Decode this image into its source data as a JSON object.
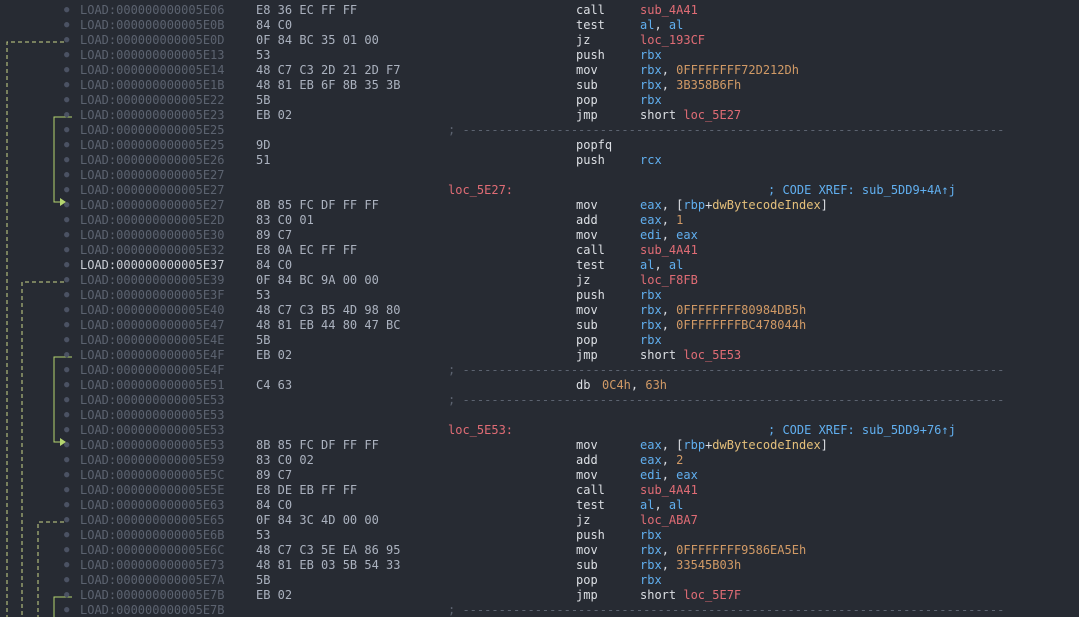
{
  "address_prefix": "LOAD:",
  "lines": [
    {
      "addr": "000000000005E06",
      "bytes": "E8 36 EC FF FF",
      "mnem": "call",
      "ops": [
        {
          "t": "sub_4A41",
          "c": "sym"
        }
      ]
    },
    {
      "addr": "000000000005E0B",
      "bytes": "84 C0",
      "mnem": "test",
      "ops": [
        {
          "t": "al",
          "c": "reg"
        },
        {
          "t": ", ",
          "c": "punc"
        },
        {
          "t": "al",
          "c": "reg"
        }
      ]
    },
    {
      "addr": "000000000005E0D",
      "bytes": "0F 84 BC 35 01 00",
      "mnem": "jz",
      "ops": [
        {
          "t": "loc_193CF",
          "c": "sym"
        }
      ]
    },
    {
      "addr": "000000000005E13",
      "bytes": "53",
      "mnem": "push",
      "ops": [
        {
          "t": "rbx",
          "c": "reg"
        }
      ]
    },
    {
      "addr": "000000000005E14",
      "bytes": "48 C7 C3 2D 21 2D F7",
      "mnem": "mov",
      "ops": [
        {
          "t": "rbx",
          "c": "reg"
        },
        {
          "t": ", ",
          "c": "punc"
        },
        {
          "t": "0FFFFFFFF72D212Dh",
          "c": "num"
        }
      ]
    },
    {
      "addr": "000000000005E1B",
      "bytes": "48 81 EB 6F 8B 35 3B",
      "mnem": "sub",
      "ops": [
        {
          "t": "rbx",
          "c": "reg"
        },
        {
          "t": ", ",
          "c": "punc"
        },
        {
          "t": "3B358B6Fh",
          "c": "num"
        }
      ]
    },
    {
      "addr": "000000000005E22",
      "bytes": "5B",
      "mnem": "pop",
      "ops": [
        {
          "t": "rbx",
          "c": "reg"
        }
      ]
    },
    {
      "addr": "000000000005E23",
      "bytes": "EB 02",
      "mnem": "jmp",
      "ops": [
        {
          "t": "short ",
          "c": "punc"
        },
        {
          "t": "loc_5E27",
          "c": "sym"
        }
      ]
    },
    {
      "addr": "000000000005E25",
      "sep": "; ---------------------------------------------------------------------------"
    },
    {
      "addr": "000000000005E25",
      "bytes": "9D",
      "mnem": "popfq",
      "ops": []
    },
    {
      "addr": "000000000005E26",
      "bytes": "51",
      "mnem": "push",
      "ops": [
        {
          "t": "rcx",
          "c": "reg"
        }
      ]
    },
    {
      "addr": "000000000005E27"
    },
    {
      "addr": "000000000005E27",
      "label": "loc_5E27:",
      "xref": "; CODE XREF: sub_5DD9+4A↑j"
    },
    {
      "addr": "000000000005E27",
      "bytes": "8B 85 FC DF FF FF",
      "mnem": "mov",
      "ops": [
        {
          "t": "eax",
          "c": "reg"
        },
        {
          "t": ", [",
          "c": "punc"
        },
        {
          "t": "rbp",
          "c": "reg"
        },
        {
          "t": "+",
          "c": "punc"
        },
        {
          "t": "dwBytecodeIndex",
          "c": "var"
        },
        {
          "t": "]",
          "c": "punc"
        }
      ]
    },
    {
      "addr": "000000000005E2D",
      "bytes": "83 C0 01",
      "mnem": "add",
      "ops": [
        {
          "t": "eax",
          "c": "reg"
        },
        {
          "t": ", ",
          "c": "punc"
        },
        {
          "t": "1",
          "c": "num"
        }
      ]
    },
    {
      "addr": "000000000005E30",
      "bytes": "89 C7",
      "mnem": "mov",
      "ops": [
        {
          "t": "edi",
          "c": "reg"
        },
        {
          "t": ", ",
          "c": "punc"
        },
        {
          "t": "eax",
          "c": "reg"
        }
      ]
    },
    {
      "addr": "000000000005E32",
      "bytes": "E8 0A EC FF FF",
      "mnem": "call",
      "ops": [
        {
          "t": "sub_4A41",
          "c": "sym"
        }
      ]
    },
    {
      "addr": "000000000005E37",
      "bytes": "84 C0",
      "mnem": "test",
      "ops": [
        {
          "t": "al",
          "c": "reg"
        },
        {
          "t": ", ",
          "c": "punc"
        },
        {
          "t": "al",
          "c": "reg"
        }
      ],
      "hl": true
    },
    {
      "addr": "000000000005E39",
      "bytes": "0F 84 BC 9A 00 00",
      "mnem": "jz",
      "ops": [
        {
          "t": "loc_F8FB",
          "c": "sym"
        }
      ]
    },
    {
      "addr": "000000000005E3F",
      "bytes": "53",
      "mnem": "push",
      "ops": [
        {
          "t": "rbx",
          "c": "reg"
        }
      ]
    },
    {
      "addr": "000000000005E40",
      "bytes": "48 C7 C3 B5 4D 98 80",
      "mnem": "mov",
      "ops": [
        {
          "t": "rbx",
          "c": "reg"
        },
        {
          "t": ", ",
          "c": "punc"
        },
        {
          "t": "0FFFFFFFF80984DB5h",
          "c": "num"
        }
      ]
    },
    {
      "addr": "000000000005E47",
      "bytes": "48 81 EB 44 80 47 BC",
      "mnem": "sub",
      "ops": [
        {
          "t": "rbx",
          "c": "reg"
        },
        {
          "t": ", ",
          "c": "punc"
        },
        {
          "t": "0FFFFFFFFBC478044h",
          "c": "num"
        }
      ]
    },
    {
      "addr": "000000000005E4E",
      "bytes": "5B",
      "mnem": "pop",
      "ops": [
        {
          "t": "rbx",
          "c": "reg"
        }
      ]
    },
    {
      "addr": "000000000005E4F",
      "bytes": "EB 02",
      "mnem": "jmp",
      "ops": [
        {
          "t": "short ",
          "c": "punc"
        },
        {
          "t": "loc_5E53",
          "c": "sym"
        }
      ]
    },
    {
      "addr": "000000000005E4F",
      "sep": "; ---------------------------------------------------------------------------"
    },
    {
      "addr": "000000000005E51",
      "bytes": "C4 63",
      "mnem": "db",
      "ops": [
        {
          "t": "0C4h",
          "c": "num"
        },
        {
          "t": ", ",
          "c": "punc"
        },
        {
          "t": "63h",
          "c": "num"
        }
      ],
      "opsAtMnemEnd": true
    },
    {
      "addr": "000000000005E53",
      "sep": "; ---------------------------------------------------------------------------"
    },
    {
      "addr": "000000000005E53"
    },
    {
      "addr": "000000000005E53",
      "label": "loc_5E53:",
      "xref": "; CODE XREF: sub_5DD9+76↑j"
    },
    {
      "addr": "000000000005E53",
      "bytes": "8B 85 FC DF FF FF",
      "mnem": "mov",
      "ops": [
        {
          "t": "eax",
          "c": "reg"
        },
        {
          "t": ", [",
          "c": "punc"
        },
        {
          "t": "rbp",
          "c": "reg"
        },
        {
          "t": "+",
          "c": "punc"
        },
        {
          "t": "dwBytecodeIndex",
          "c": "var"
        },
        {
          "t": "]",
          "c": "punc"
        }
      ]
    },
    {
      "addr": "000000000005E59",
      "bytes": "83 C0 02",
      "mnem": "add",
      "ops": [
        {
          "t": "eax",
          "c": "reg"
        },
        {
          "t": ", ",
          "c": "punc"
        },
        {
          "t": "2",
          "c": "num"
        }
      ]
    },
    {
      "addr": "000000000005E5C",
      "bytes": "89 C7",
      "mnem": "mov",
      "ops": [
        {
          "t": "edi",
          "c": "reg"
        },
        {
          "t": ", ",
          "c": "punc"
        },
        {
          "t": "eax",
          "c": "reg"
        }
      ]
    },
    {
      "addr": "000000000005E5E",
      "bytes": "E8 DE EB FF FF",
      "mnem": "call",
      "ops": [
        {
          "t": "sub_4A41",
          "c": "sym"
        }
      ]
    },
    {
      "addr": "000000000005E63",
      "bytes": "84 C0",
      "mnem": "test",
      "ops": [
        {
          "t": "al",
          "c": "reg"
        },
        {
          "t": ", ",
          "c": "punc"
        },
        {
          "t": "al",
          "c": "reg"
        }
      ]
    },
    {
      "addr": "000000000005E65",
      "bytes": "0F 84 3C 4D 00 00",
      "mnem": "jz",
      "ops": [
        {
          "t": "loc_ABA7",
          "c": "sym"
        }
      ]
    },
    {
      "addr": "000000000005E6B",
      "bytes": "53",
      "mnem": "push",
      "ops": [
        {
          "t": "rbx",
          "c": "reg"
        }
      ]
    },
    {
      "addr": "000000000005E6C",
      "bytes": "48 C7 C3 5E EA 86 95",
      "mnem": "mov",
      "ops": [
        {
          "t": "rbx",
          "c": "reg"
        },
        {
          "t": ", ",
          "c": "punc"
        },
        {
          "t": "0FFFFFFFF9586EA5Eh",
          "c": "num"
        }
      ]
    },
    {
      "addr": "000000000005E73",
      "bytes": "48 81 EB 03 5B 54 33",
      "mnem": "sub",
      "ops": [
        {
          "t": "rbx",
          "c": "reg"
        },
        {
          "t": ", ",
          "c": "punc"
        },
        {
          "t": "33545B03h",
          "c": "num"
        }
      ]
    },
    {
      "addr": "000000000005E7A",
      "bytes": "5B",
      "mnem": "pop",
      "ops": [
        {
          "t": "rbx",
          "c": "reg"
        }
      ]
    },
    {
      "addr": "000000000005E7B",
      "bytes": "EB 02",
      "mnem": "jmp",
      "ops": [
        {
          "t": "short ",
          "c": "punc"
        },
        {
          "t": "loc_5E7F",
          "c": "sym"
        }
      ]
    },
    {
      "addr": "000000000005E7B",
      "sep": "; ---------------------------------------------------------------------------"
    }
  ],
  "colors": {
    "background": "#272b33",
    "address": "#5c6370",
    "register": "#61afef",
    "number": "#d19a66",
    "symbol": "#e06c75",
    "variable": "#e5c07b",
    "arrow_taken": "#b5d66f",
    "arrow_conditional": "#c8d48a"
  }
}
